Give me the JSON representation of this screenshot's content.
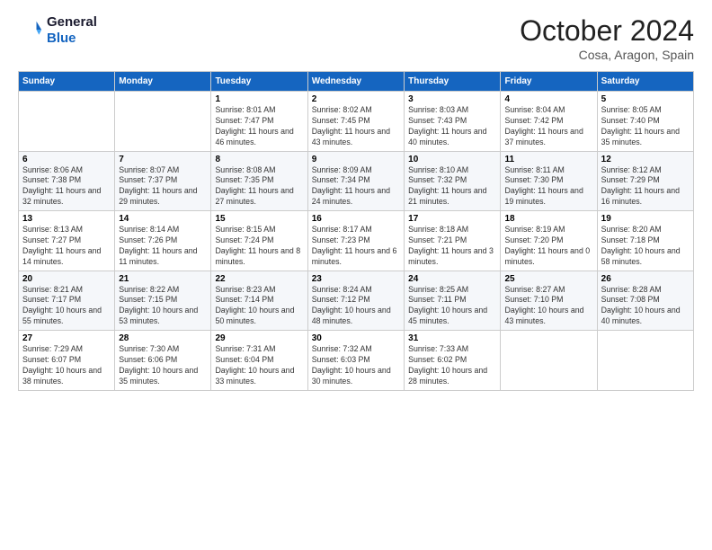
{
  "header": {
    "logo_line1": "General",
    "logo_line2": "Blue",
    "month": "October 2024",
    "location": "Cosa, Aragon, Spain"
  },
  "weekdays": [
    "Sunday",
    "Monday",
    "Tuesday",
    "Wednesday",
    "Thursday",
    "Friday",
    "Saturday"
  ],
  "weeks": [
    [
      {
        "day": "",
        "info": ""
      },
      {
        "day": "",
        "info": ""
      },
      {
        "day": "1",
        "info": "Sunrise: 8:01 AM\nSunset: 7:47 PM\nDaylight: 11 hours and 46 minutes."
      },
      {
        "day": "2",
        "info": "Sunrise: 8:02 AM\nSunset: 7:45 PM\nDaylight: 11 hours and 43 minutes."
      },
      {
        "day": "3",
        "info": "Sunrise: 8:03 AM\nSunset: 7:43 PM\nDaylight: 11 hours and 40 minutes."
      },
      {
        "day": "4",
        "info": "Sunrise: 8:04 AM\nSunset: 7:42 PM\nDaylight: 11 hours and 37 minutes."
      },
      {
        "day": "5",
        "info": "Sunrise: 8:05 AM\nSunset: 7:40 PM\nDaylight: 11 hours and 35 minutes."
      }
    ],
    [
      {
        "day": "6",
        "info": "Sunrise: 8:06 AM\nSunset: 7:38 PM\nDaylight: 11 hours and 32 minutes."
      },
      {
        "day": "7",
        "info": "Sunrise: 8:07 AM\nSunset: 7:37 PM\nDaylight: 11 hours and 29 minutes."
      },
      {
        "day": "8",
        "info": "Sunrise: 8:08 AM\nSunset: 7:35 PM\nDaylight: 11 hours and 27 minutes."
      },
      {
        "day": "9",
        "info": "Sunrise: 8:09 AM\nSunset: 7:34 PM\nDaylight: 11 hours and 24 minutes."
      },
      {
        "day": "10",
        "info": "Sunrise: 8:10 AM\nSunset: 7:32 PM\nDaylight: 11 hours and 21 minutes."
      },
      {
        "day": "11",
        "info": "Sunrise: 8:11 AM\nSunset: 7:30 PM\nDaylight: 11 hours and 19 minutes."
      },
      {
        "day": "12",
        "info": "Sunrise: 8:12 AM\nSunset: 7:29 PM\nDaylight: 11 hours and 16 minutes."
      }
    ],
    [
      {
        "day": "13",
        "info": "Sunrise: 8:13 AM\nSunset: 7:27 PM\nDaylight: 11 hours and 14 minutes."
      },
      {
        "day": "14",
        "info": "Sunrise: 8:14 AM\nSunset: 7:26 PM\nDaylight: 11 hours and 11 minutes."
      },
      {
        "day": "15",
        "info": "Sunrise: 8:15 AM\nSunset: 7:24 PM\nDaylight: 11 hours and 8 minutes."
      },
      {
        "day": "16",
        "info": "Sunrise: 8:17 AM\nSunset: 7:23 PM\nDaylight: 11 hours and 6 minutes."
      },
      {
        "day": "17",
        "info": "Sunrise: 8:18 AM\nSunset: 7:21 PM\nDaylight: 11 hours and 3 minutes."
      },
      {
        "day": "18",
        "info": "Sunrise: 8:19 AM\nSunset: 7:20 PM\nDaylight: 11 hours and 0 minutes."
      },
      {
        "day": "19",
        "info": "Sunrise: 8:20 AM\nSunset: 7:18 PM\nDaylight: 10 hours and 58 minutes."
      }
    ],
    [
      {
        "day": "20",
        "info": "Sunrise: 8:21 AM\nSunset: 7:17 PM\nDaylight: 10 hours and 55 minutes."
      },
      {
        "day": "21",
        "info": "Sunrise: 8:22 AM\nSunset: 7:15 PM\nDaylight: 10 hours and 53 minutes."
      },
      {
        "day": "22",
        "info": "Sunrise: 8:23 AM\nSunset: 7:14 PM\nDaylight: 10 hours and 50 minutes."
      },
      {
        "day": "23",
        "info": "Sunrise: 8:24 AM\nSunset: 7:12 PM\nDaylight: 10 hours and 48 minutes."
      },
      {
        "day": "24",
        "info": "Sunrise: 8:25 AM\nSunset: 7:11 PM\nDaylight: 10 hours and 45 minutes."
      },
      {
        "day": "25",
        "info": "Sunrise: 8:27 AM\nSunset: 7:10 PM\nDaylight: 10 hours and 43 minutes."
      },
      {
        "day": "26",
        "info": "Sunrise: 8:28 AM\nSunset: 7:08 PM\nDaylight: 10 hours and 40 minutes."
      }
    ],
    [
      {
        "day": "27",
        "info": "Sunrise: 7:29 AM\nSunset: 6:07 PM\nDaylight: 10 hours and 38 minutes."
      },
      {
        "day": "28",
        "info": "Sunrise: 7:30 AM\nSunset: 6:06 PM\nDaylight: 10 hours and 35 minutes."
      },
      {
        "day": "29",
        "info": "Sunrise: 7:31 AM\nSunset: 6:04 PM\nDaylight: 10 hours and 33 minutes."
      },
      {
        "day": "30",
        "info": "Sunrise: 7:32 AM\nSunset: 6:03 PM\nDaylight: 10 hours and 30 minutes."
      },
      {
        "day": "31",
        "info": "Sunrise: 7:33 AM\nSunset: 6:02 PM\nDaylight: 10 hours and 28 minutes."
      },
      {
        "day": "",
        "info": ""
      },
      {
        "day": "",
        "info": ""
      }
    ]
  ]
}
